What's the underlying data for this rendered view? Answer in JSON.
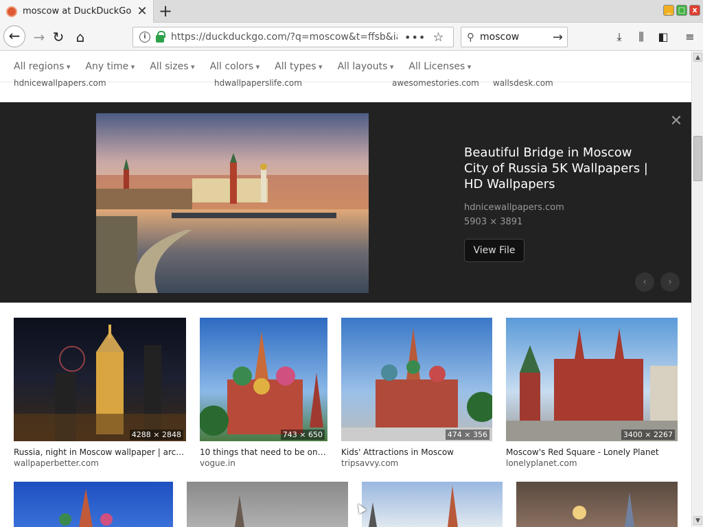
{
  "browser": {
    "tab_title": "moscow at DuckDuckGo",
    "new_tab_symbol": "+",
    "url": "https://duckduckgo.com/?q=moscow&t=ffsb&iax",
    "search_query": "moscow",
    "window_buttons": {
      "minimize": "_",
      "maximize": "□",
      "close": "x"
    }
  },
  "filters": [
    "All regions",
    "Any time",
    "All sizes",
    "All colors",
    "All types",
    "All layouts",
    "All Licenses"
  ],
  "source_row": [
    "hdnicewallpapers.com",
    "hdwallpaperslife.com",
    "awesomestories.com",
    "wallsdesk.com"
  ],
  "detail": {
    "title": "Beautiful Bridge in Moscow City of Russia 5K Wallpapers | HD Wallpapers",
    "site": "hdnicewallpapers.com",
    "dimensions": "5903 × 3891",
    "view_button": "View File",
    "prev_symbol": "‹",
    "next_symbol": "›",
    "close_symbol": "✕"
  },
  "results": [
    {
      "title": "Russia, night in Moscow wallpaper | archit...",
      "site": "wallpaperbetter.com",
      "dim": "4288 × 2848"
    },
    {
      "title": "10 things that need to be on yo...",
      "site": "vogue.in",
      "dim": "743 × 650"
    },
    {
      "title": "Kids' Attractions in Moscow",
      "site": "tripsavvy.com",
      "dim": "474 × 356"
    },
    {
      "title": "Moscow's Red Square - Lonely Planet",
      "site": "lonelyplanet.com",
      "dim": "3400 × 2267"
    }
  ],
  "colors": {
    "accent": "#de5833",
    "lock": "#2da24a",
    "panel": "#222222"
  }
}
